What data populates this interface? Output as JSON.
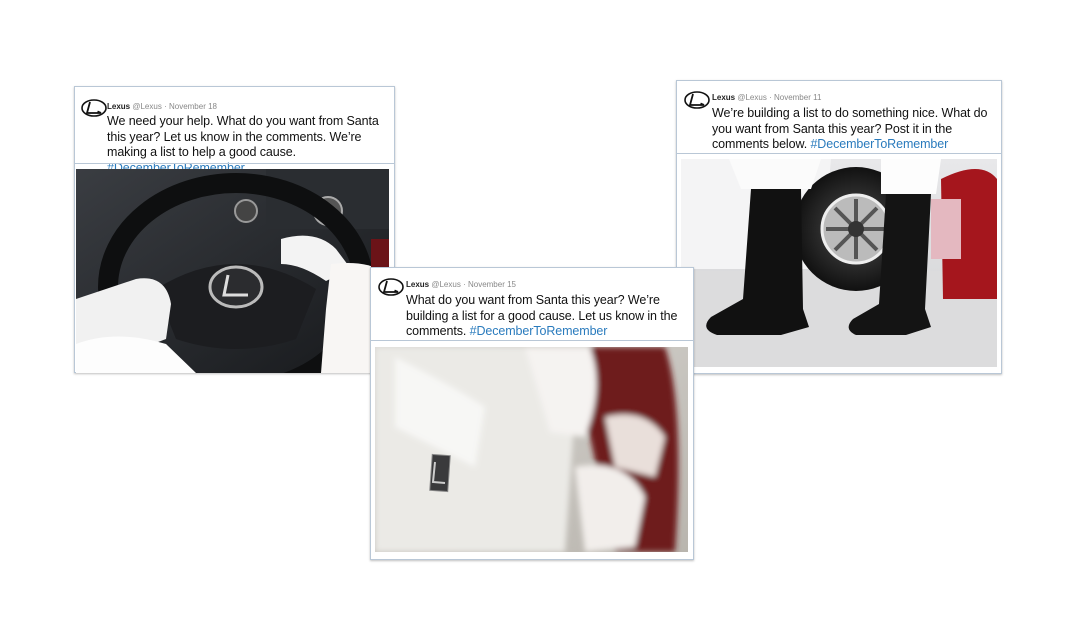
{
  "tweets": [
    {
      "account_name": "Lexus",
      "handle": "@Lexus",
      "separator": "·",
      "date": "November 18",
      "text": "We need your help. What do you want from Santa this year? Let us know in the comments. We’re making a list to help a good cause.",
      "hashtag": "#DecemberToRemember",
      "image": "santa-hands-on-steering-wheel"
    },
    {
      "account_name": "Lexus",
      "handle": "@Lexus",
      "separator": "·",
      "date": "November 15",
      "text": "What do you want from Santa this year? We’re building a list for a good cause. Let us know in the comments.",
      "hashtag": "#DecemberToRemember",
      "image": "santa-opening-white-car-door"
    },
    {
      "account_name": "Lexus",
      "handle": "@Lexus",
      "separator": "·",
      "date": "November 11",
      "text": "We’re building a list to do something nice. What do you want from Santa this year? Post it in the comments below.",
      "hashtag": "#DecemberToRemember",
      "image": "santa-boots-beside-car-wheel"
    }
  ],
  "colors": {
    "hashtag": "#2a7bbd",
    "border": "#b9c7d6",
    "text": "#111111"
  },
  "icons": {
    "logo": "lexus-logo-icon"
  }
}
